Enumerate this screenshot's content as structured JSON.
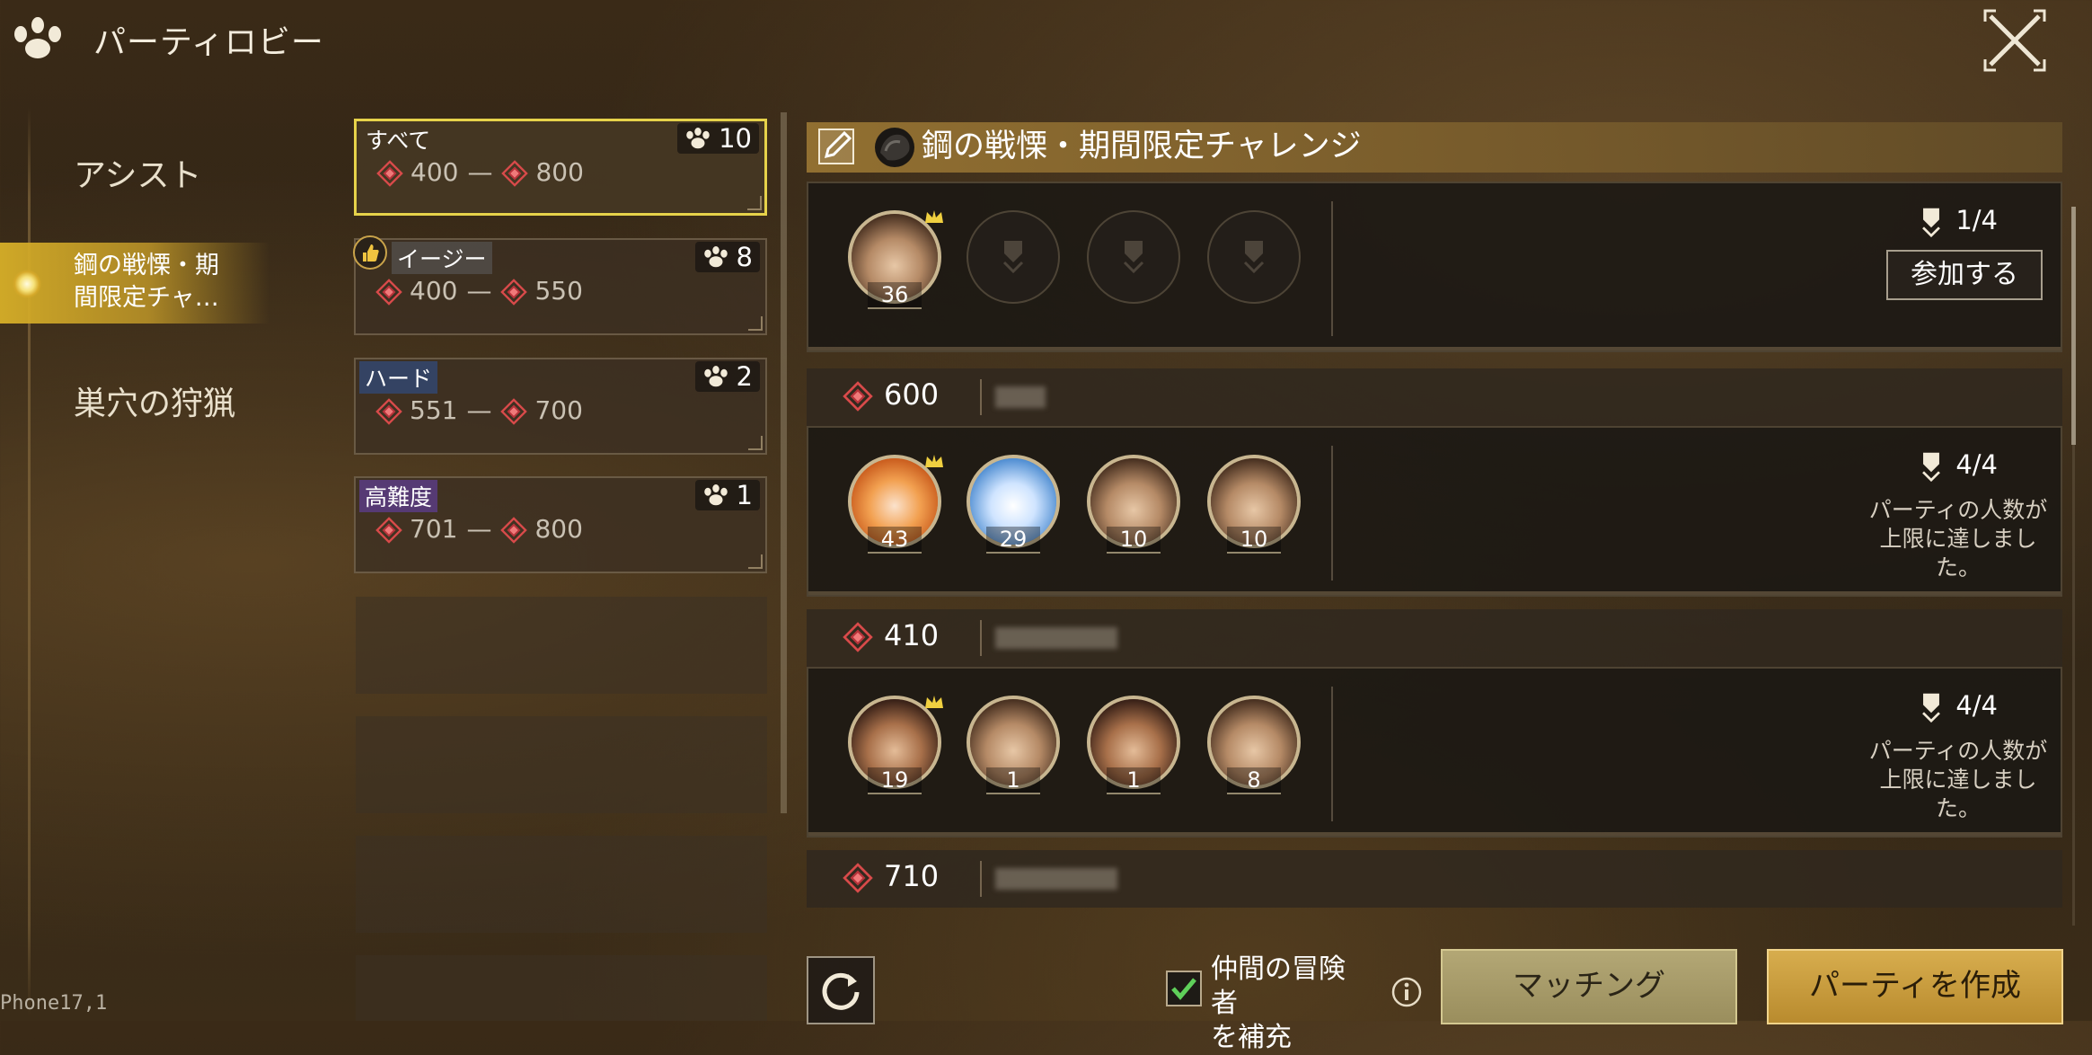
{
  "header": {
    "title": "パーティロビー",
    "logo_icon": "paw-emblem-icon",
    "close_icon": "close-icon"
  },
  "sidebar": {
    "items": [
      {
        "label": "アシスト"
      },
      {
        "label": "鋼の戦慄・期間限定チャ…",
        "line1": "鋼の戦慄・期",
        "line2": "間限定チャ…",
        "active": true
      },
      {
        "label": "巣穴の狩猟"
      }
    ]
  },
  "difficulties": [
    {
      "name": "すべて",
      "count": "10",
      "min": "400",
      "max": "800",
      "selected": true
    },
    {
      "name": "イージー",
      "count": "8",
      "min": "400",
      "max": "550",
      "recommended_icon": "thumbs-up-icon"
    },
    {
      "name": "ハード",
      "count": "2",
      "min": "551",
      "max": "700"
    },
    {
      "name": "高難度",
      "count": "1",
      "min": "701",
      "max": "800"
    }
  ],
  "quest": {
    "title": "鋼の戦慄・期間限定チャレンジ"
  },
  "parties": [
    {
      "score": "",
      "members": [
        "36"
      ],
      "count": "1/4",
      "action": "参加する"
    },
    {
      "score": "600",
      "members": [
        "43",
        "29",
        "10",
        "10"
      ],
      "count": "4/4",
      "full_text": "パーティの人数が上限に達しました。",
      "full_line1": "パーティの人数が",
      "full_line2": "上限に達しまし",
      "full_line3": "た。"
    },
    {
      "score": "410",
      "members": [
        "19",
        "1",
        "1",
        "8"
      ],
      "count": "4/4",
      "full_text": "パーティの人数が上限に達しました。",
      "full_line1": "パーティの人数が",
      "full_line2": "上限に達しまし",
      "full_line3": "た。"
    },
    {
      "score": "710"
    }
  ],
  "footer": {
    "supplement_line1": "仲間の冒険者",
    "supplement_line2": "を補充",
    "supplement_checked": true,
    "match": "マッチング",
    "create": "パーティを作成"
  },
  "device_label": "Phone17,1",
  "colors": {
    "accent_gold": "#e6d24a",
    "gem_red": "#d84a4a"
  }
}
